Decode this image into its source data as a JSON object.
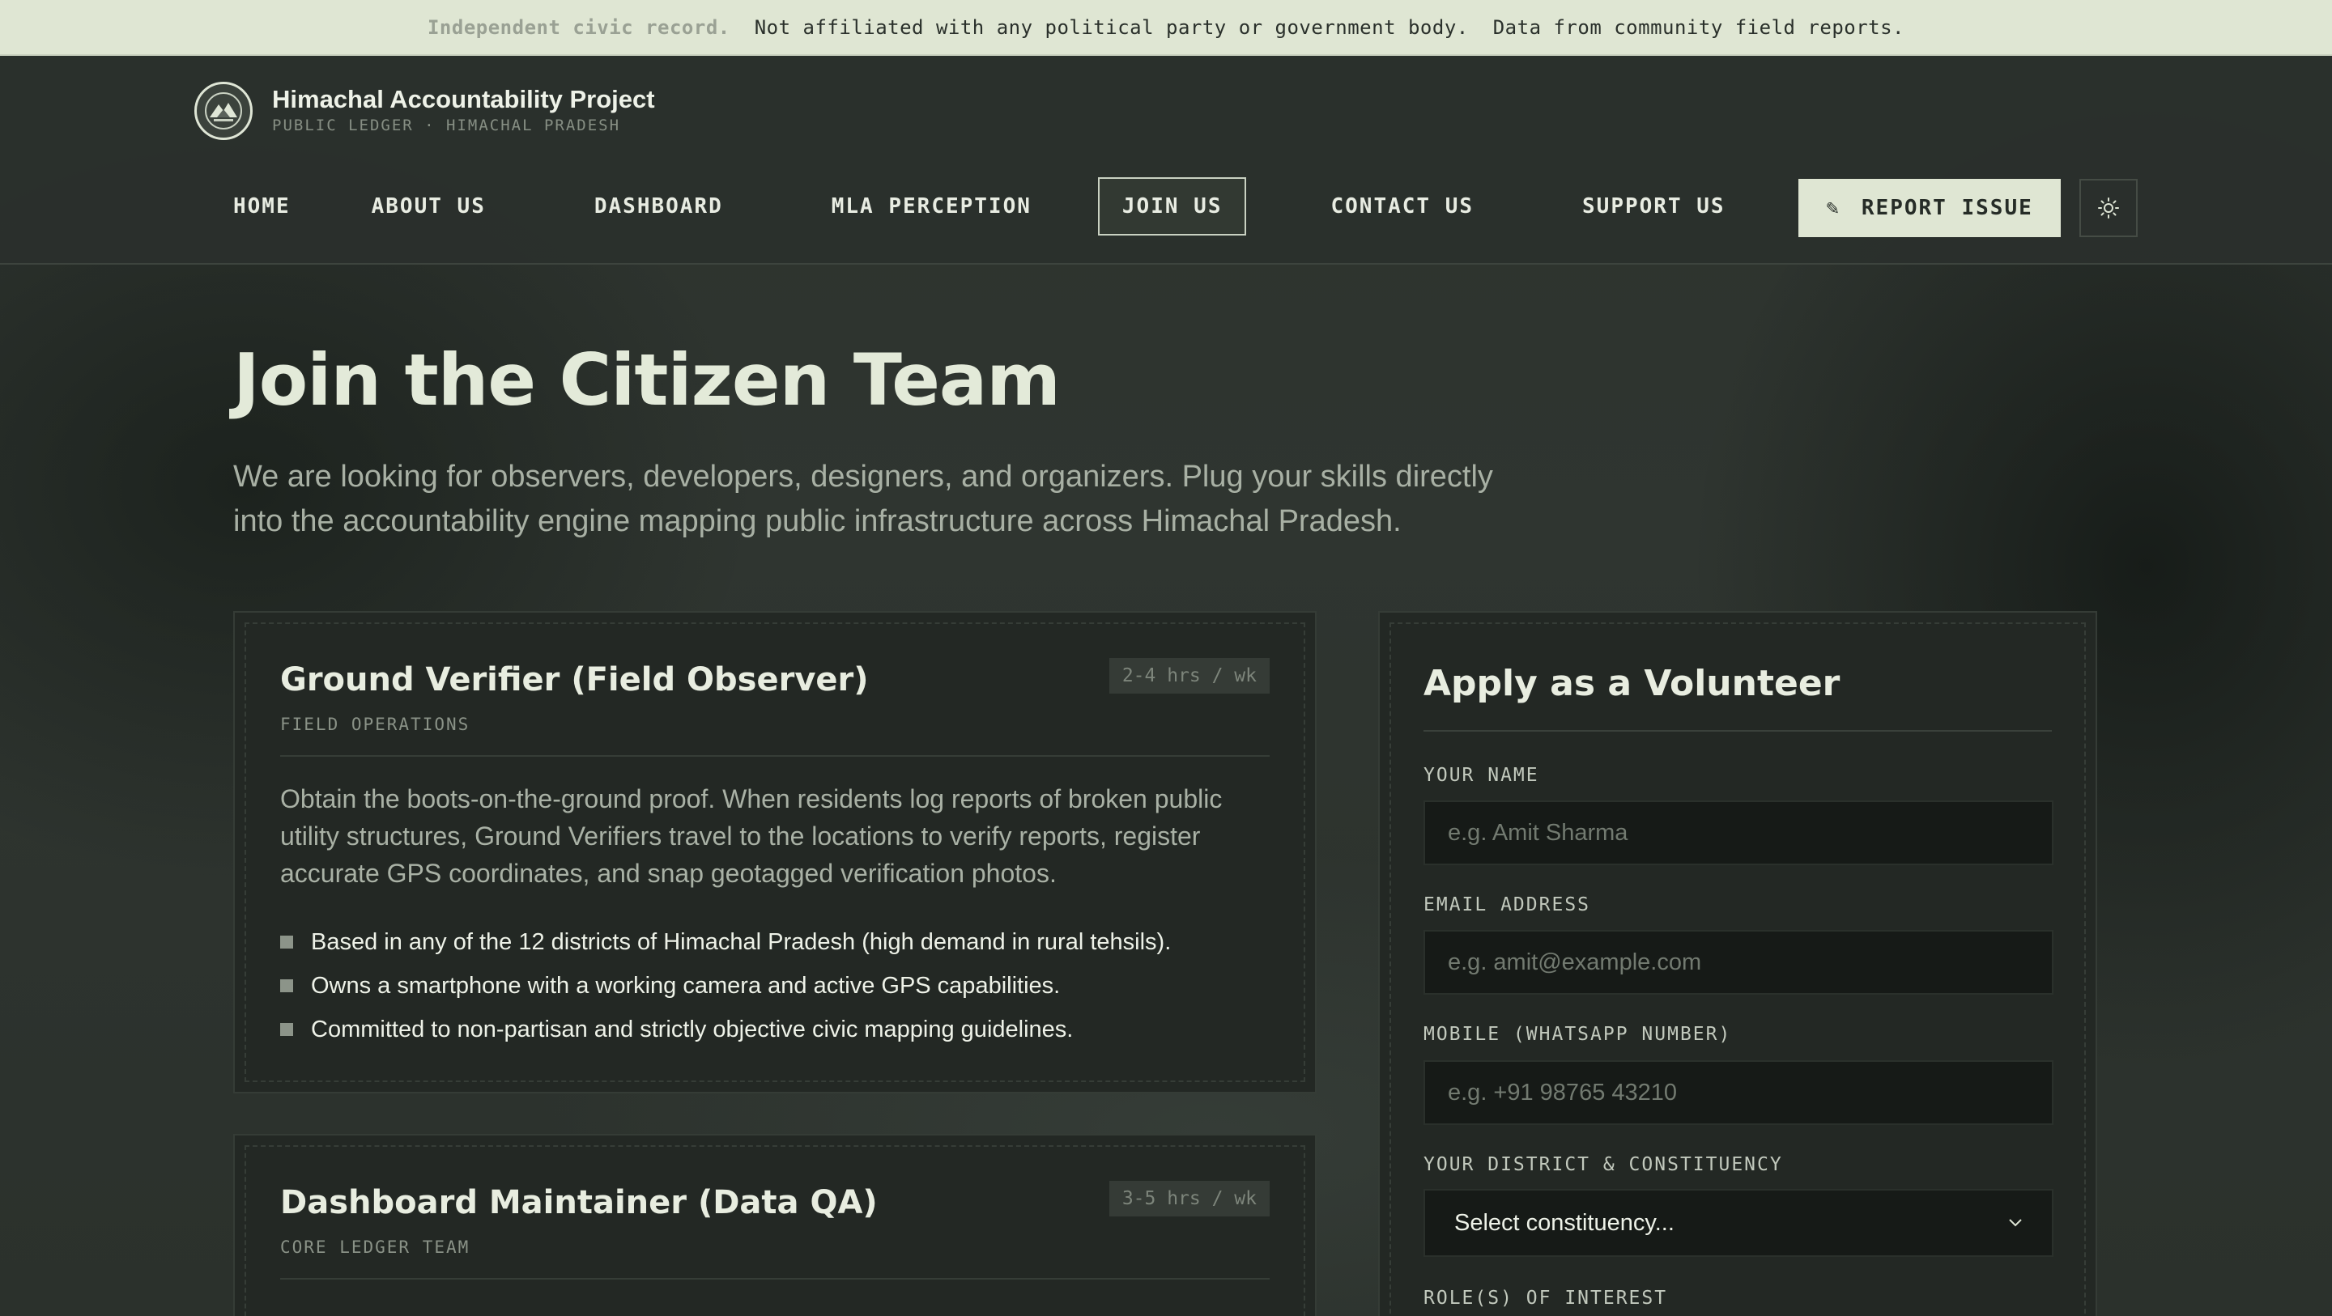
{
  "notice": {
    "muted": "Independent civic record.",
    "text1": "Not affiliated with any political party or government body.",
    "text2": "Data from community field reports."
  },
  "brand": {
    "title": "Himachal Accountability Project",
    "subtitle": "PUBLIC LEDGER · HIMACHAL PRADESH"
  },
  "nav": {
    "items": [
      "HOME",
      "ABOUT US",
      "DASHBOARD",
      "MLA PERCEPTION",
      "JOIN US",
      "CONTACT US",
      "SUPPORT US"
    ],
    "active": "JOIN US",
    "report_icon": "✎",
    "report_label": "REPORT ISSUE",
    "theme_icon": "sun-icon"
  },
  "hero": {
    "title": "Join the Citizen Team",
    "subtitle": "We are looking for observers, developers, designers, and organizers. Plug your skills directly into the accountability engine mapping public infrastructure across Himachal Pradesh."
  },
  "roles": [
    {
      "title": "Ground Verifier (Field Observer)",
      "category": "FIELD OPERATIONS",
      "hours": "2-4 hrs / wk",
      "description": "Obtain the boots-on-the-ground proof. When residents log reports of broken public utility structures, Ground Verifiers travel to the locations to verify reports, register accurate GPS coordinates, and snap geotagged verification photos.",
      "requirements": [
        "Based in any of the 12 districts of Himachal Pradesh (high demand in rural tehsils).",
        "Owns a smartphone with a working camera and active GPS capabilities.",
        "Committed to non-partisan and strictly objective civic mapping guidelines."
      ]
    },
    {
      "title": "Dashboard Maintainer (Data QA)",
      "category": "CORE LEDGER TEAM",
      "hours": "3-5 hrs / wk"
    }
  ],
  "form": {
    "title": "Apply as a Volunteer",
    "name_label": "YOUR NAME",
    "name_placeholder": "e.g. Amit Sharma",
    "email_label": "EMAIL ADDRESS",
    "email_placeholder": "e.g. amit@example.com",
    "mobile_label": "MOBILE (WHATSAPP NUMBER)",
    "mobile_placeholder": "e.g. +91 98765 43210",
    "district_label": "YOUR DISTRICT & CONSTITUENCY",
    "district_value": "Select constituency...",
    "roles_label": "ROLE(S) OF INTEREST"
  },
  "colors": {
    "background": "#2a302b",
    "notice_bar": "#dfe6d3",
    "accent_button": "#dfe6d3",
    "card": "#232824",
    "input": "#161a17"
  }
}
